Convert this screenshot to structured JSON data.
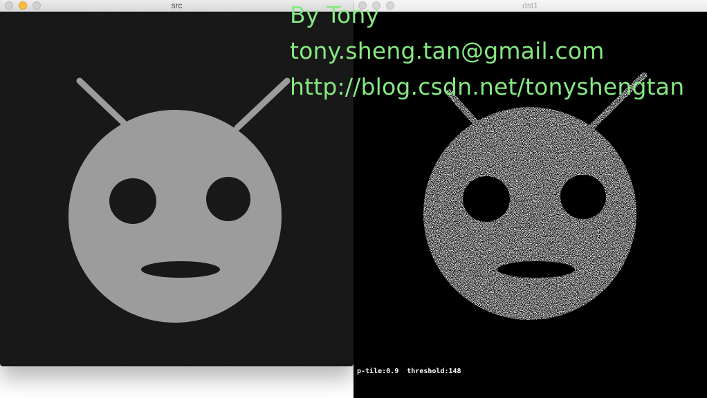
{
  "windows": {
    "src": {
      "title": "src"
    },
    "dst": {
      "title": "dst1"
    }
  },
  "overlay": {
    "line1": "By Tony",
    "line2": "tony.sheng.tan@gmail.com",
    "line3": "http://blog.csdn.net/tonyshengtan"
  },
  "status": {
    "p_tile_label": "p-tile:",
    "p_tile_value": "0.9",
    "threshold_label": "threshold:",
    "threshold_value": "148"
  },
  "colors": {
    "overlay_text": "#86e882",
    "src_background": "#141414",
    "src_face": "#9a9a9a",
    "dst_background": "#000000",
    "dst_face_speckle": "#ffffff"
  },
  "icons": {
    "close": "close-dot",
    "minimize": "minimize-dot",
    "zoom": "zoom-dot"
  }
}
